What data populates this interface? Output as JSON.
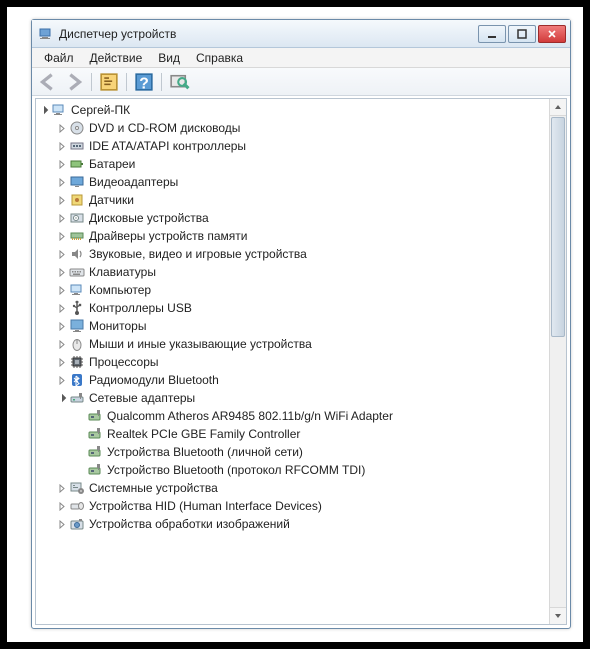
{
  "window": {
    "title": "Диспетчер устройств"
  },
  "menu": {
    "file": "Файл",
    "action": "Действие",
    "view": "Вид",
    "help": "Справка"
  },
  "tree": {
    "root": {
      "label": "Сергей-ПК",
      "expanded": true,
      "icon": "computer"
    },
    "categories": [
      {
        "label": "DVD и CD-ROM дисководы",
        "icon": "disc",
        "expanded": false
      },
      {
        "label": "IDE ATA/ATAPI контроллеры",
        "icon": "ide",
        "expanded": false
      },
      {
        "label": "Батареи",
        "icon": "battery",
        "expanded": false
      },
      {
        "label": "Видеоадаптеры",
        "icon": "display",
        "expanded": false
      },
      {
        "label": "Датчики",
        "icon": "sensor",
        "expanded": false
      },
      {
        "label": "Дисковые устройства",
        "icon": "hdd",
        "expanded": false
      },
      {
        "label": "Драйверы устройств памяти",
        "icon": "memory",
        "expanded": false
      },
      {
        "label": "Звуковые, видео и игровые устройства",
        "icon": "sound",
        "expanded": false
      },
      {
        "label": "Клавиатуры",
        "icon": "keyboard",
        "expanded": false
      },
      {
        "label": "Компьютер",
        "icon": "computer",
        "expanded": false
      },
      {
        "label": "Контроллеры USB",
        "icon": "usb",
        "expanded": false
      },
      {
        "label": "Мониторы",
        "icon": "monitor",
        "expanded": false
      },
      {
        "label": "Мыши и иные указывающие устройства",
        "icon": "mouse",
        "expanded": false
      },
      {
        "label": "Процессоры",
        "icon": "cpu",
        "expanded": false
      },
      {
        "label": "Радиомодули Bluetooth",
        "icon": "bluetooth",
        "expanded": false
      },
      {
        "label": "Сетевые адаптеры",
        "icon": "network",
        "expanded": true,
        "children": [
          {
            "label": "Qualcomm Atheros AR9485 802.11b/g/n WiFi Adapter",
            "icon": "netcard"
          },
          {
            "label": "Realtek PCIe GBE Family Controller",
            "icon": "netcard"
          },
          {
            "label": "Устройства Bluetooth (личной сети)",
            "icon": "netcard"
          },
          {
            "label": "Устройство Bluetooth (протокол RFCOMM TDI)",
            "icon": "netcard"
          }
        ]
      },
      {
        "label": "Системные устройства",
        "icon": "system",
        "expanded": false
      },
      {
        "label": "Устройства HID (Human Interface Devices)",
        "icon": "hid",
        "expanded": false
      },
      {
        "label": "Устройства обработки изображений",
        "icon": "imaging",
        "expanded": false
      }
    ]
  }
}
